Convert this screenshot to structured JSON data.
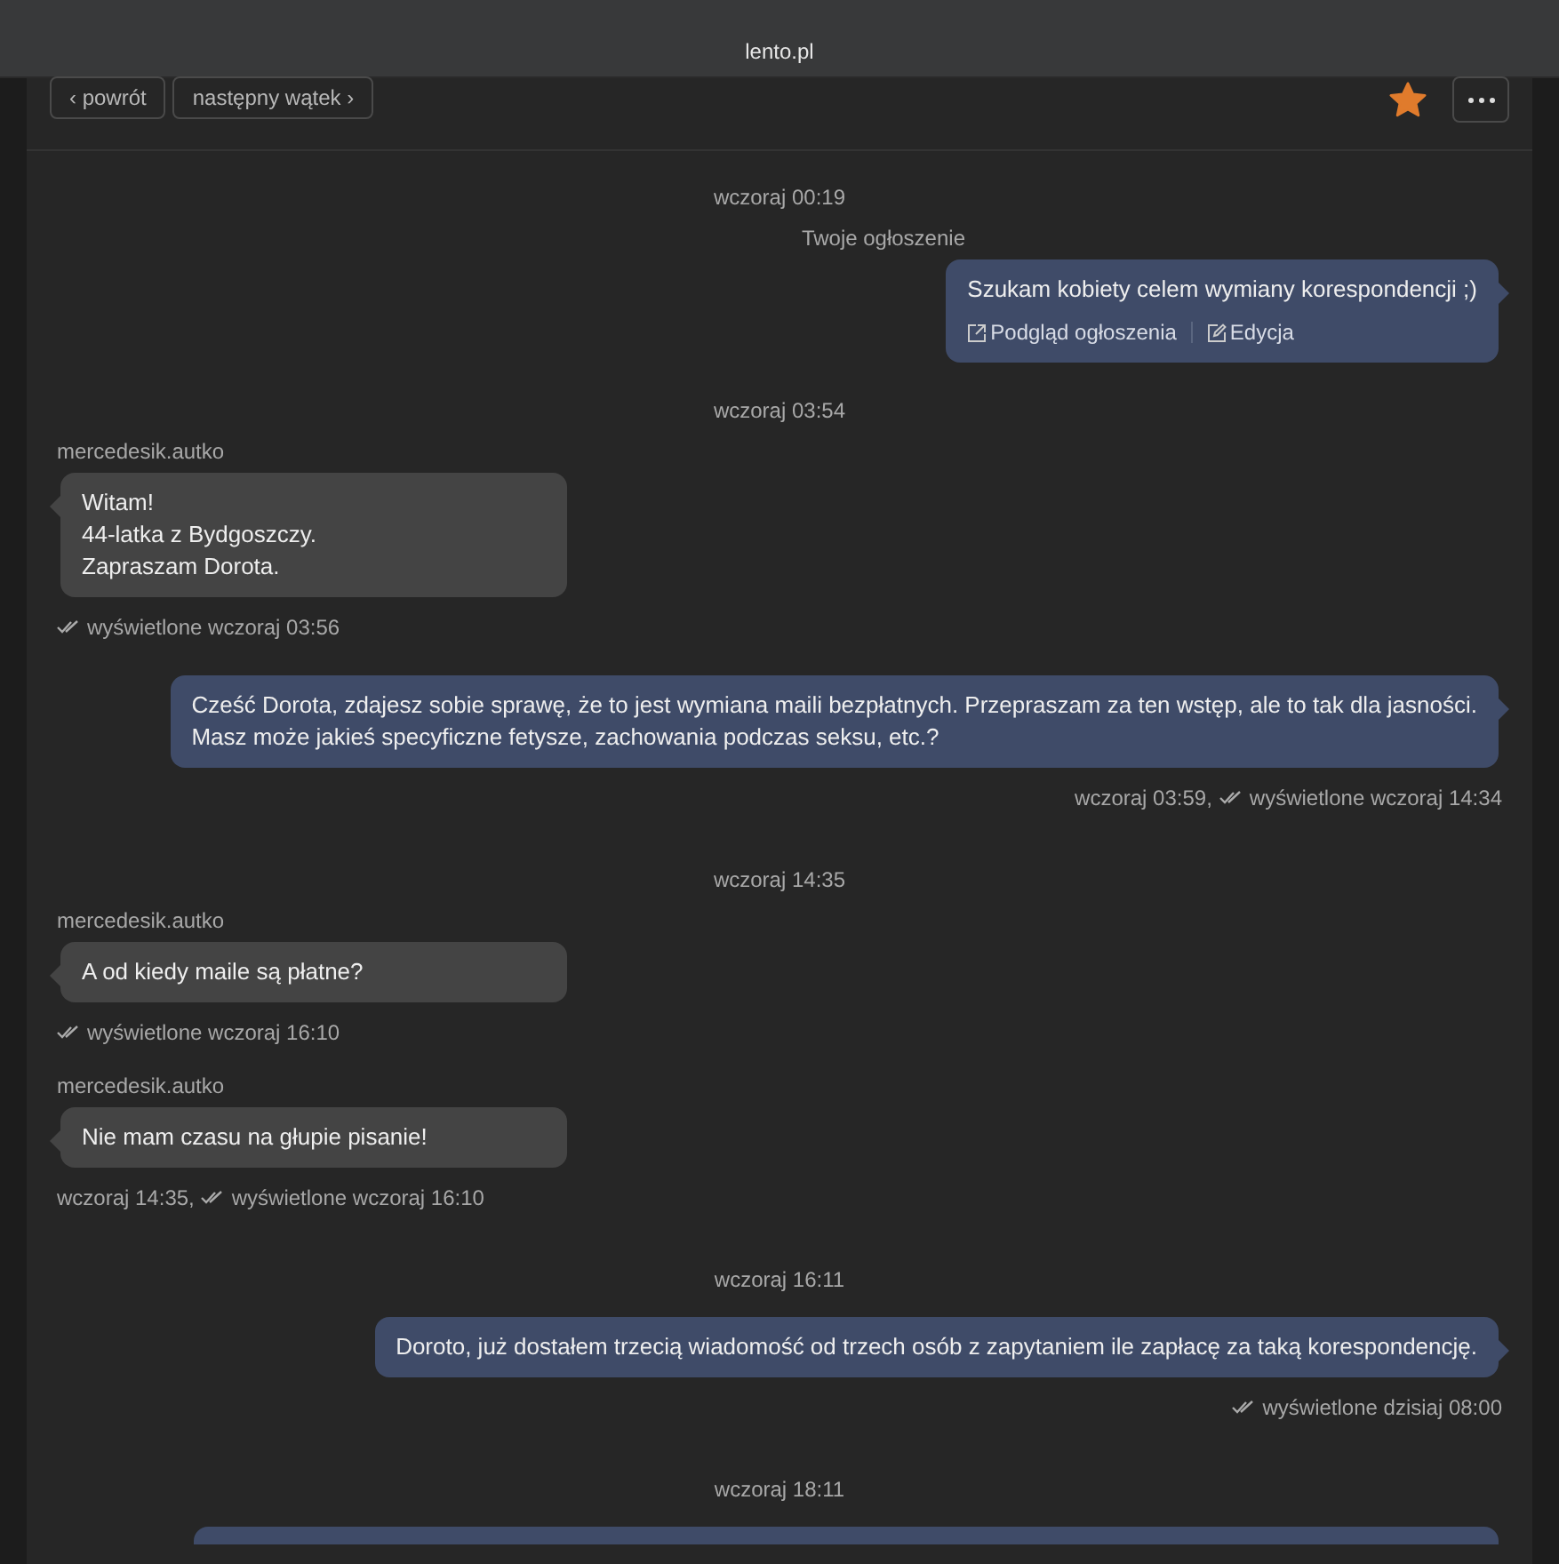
{
  "browser_bar": {
    "title": "lento.pl"
  },
  "toolbar": {
    "back": "‹ powrót",
    "next": "następny wątek ›",
    "starred": true
  },
  "thread": [
    {
      "kind": "time",
      "text": "wczoraj 00:19"
    },
    {
      "kind": "message",
      "outgoing": true,
      "sender": "Twoje ogłoszenie",
      "lines": [
        "Szukam kobiety celem wymiany korespondencji ;)"
      ],
      "links": [
        "Podgląd ogłoszenia",
        "Edycja"
      ]
    },
    {
      "kind": "time",
      "text": "wczoraj 03:54"
    },
    {
      "kind": "message",
      "outgoing": false,
      "sender": "mercedesik.autko",
      "lines": [
        "Witam!",
        "44-latka z Bydgoszczy.",
        "Zapraszam Dorota."
      ],
      "footer": {
        "seen": "wyświetlone wczoraj 03:56"
      }
    },
    {
      "kind": "message",
      "outgoing": true,
      "lines": [
        "Cześć Dorota, zdajesz sobie sprawę, że to jest wymiana maili bezpłatnych. Przepraszam za ten wstęp, ale to tak dla jasności.",
        "Masz może jakieś specyficzne fetysze, zachowania podczas seksu, etc.?"
      ],
      "footer": {
        "time": "wczoraj 03:59,",
        "seen": "wyświetlone wczoraj 14:34"
      }
    },
    {
      "kind": "time",
      "text": "wczoraj 14:35"
    },
    {
      "kind": "message",
      "outgoing": false,
      "sender": "mercedesik.autko",
      "lines": [
        "A od kiedy maile są płatne?"
      ],
      "footer": {
        "seen": "wyświetlone wczoraj 16:10"
      }
    },
    {
      "kind": "message",
      "outgoing": false,
      "sender": "mercedesik.autko",
      "lines": [
        "Nie mam czasu na głupie pisanie!"
      ],
      "footer": {
        "time": "wczoraj 14:35,",
        "seen": "wyświetlone wczoraj 16:10"
      }
    },
    {
      "kind": "time",
      "text": "wczoraj 16:11"
    },
    {
      "kind": "message",
      "outgoing": true,
      "lines": [
        "Doroto, już dostałem trzecią wiadomość od trzech osób z zapytaniem ile zapłacę za taką korespondencję."
      ],
      "footer": {
        "seen": "wyświetlone dzisiaj 08:00"
      }
    },
    {
      "kind": "time",
      "text": "wczoraj 18:11"
    },
    {
      "kind": "partial",
      "outgoing": true
    }
  ]
}
